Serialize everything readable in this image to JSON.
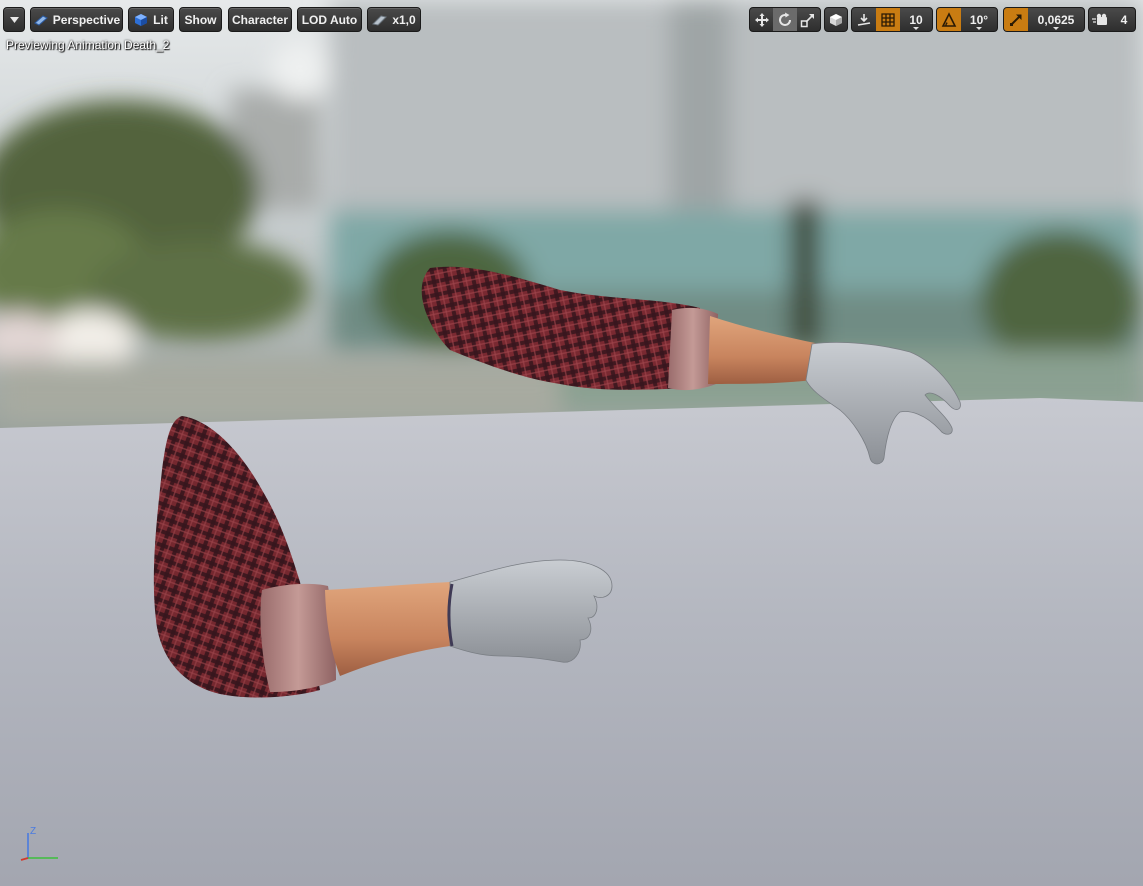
{
  "viewport": {
    "preview_text": "Previewing Animation Death_2"
  },
  "toolbar_left": {
    "menu_icon": "chevron-down-icon",
    "perspective": {
      "label": "Perspective",
      "icon": "perspective-view-icon"
    },
    "lit": {
      "label": "Lit",
      "icon": "lit-cube-icon"
    },
    "show": "Show",
    "character": "Character",
    "lod": "LOD Auto",
    "speed": {
      "label": "x1,0",
      "icon": "playback-speed-icon"
    }
  },
  "toolbar_right": {
    "transform_modes": [
      "translate-icon",
      "rotate-icon",
      "scale-icon"
    ],
    "active_transform": "rotate-icon",
    "coordinate_space_icon": "world-cube-icon",
    "surface_snap_icon": "surface-snap-icon",
    "grid_snap": {
      "icon": "grid-icon",
      "value": "10"
    },
    "rotation_snap": {
      "icon": "rotation-snap-icon",
      "value": "10°"
    },
    "scale_snap": {
      "icon": "scale-snap-icon",
      "value": "0,0625"
    },
    "camera_speed": {
      "icon": "camera-speed-icon",
      "value": "4"
    },
    "accent_color": "#c97c12"
  },
  "axis_gizmo": {
    "z_label": "Z",
    "colors": {
      "x": "#d23a2a",
      "y": "#3cbf3c",
      "z": "#4a7be0"
    }
  }
}
